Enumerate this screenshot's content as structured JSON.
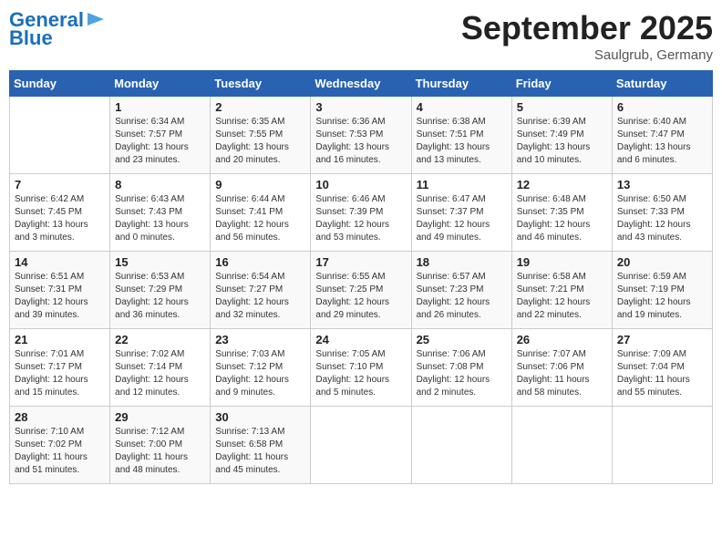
{
  "logo": {
    "line1": "General",
    "line2": "Blue"
  },
  "title": "September 2025",
  "subtitle": "Saulgrub, Germany",
  "headers": [
    "Sunday",
    "Monday",
    "Tuesday",
    "Wednesday",
    "Thursday",
    "Friday",
    "Saturday"
  ],
  "weeks": [
    [
      {
        "day": "",
        "info": ""
      },
      {
        "day": "1",
        "info": "Sunrise: 6:34 AM\nSunset: 7:57 PM\nDaylight: 13 hours\nand 23 minutes."
      },
      {
        "day": "2",
        "info": "Sunrise: 6:35 AM\nSunset: 7:55 PM\nDaylight: 13 hours\nand 20 minutes."
      },
      {
        "day": "3",
        "info": "Sunrise: 6:36 AM\nSunset: 7:53 PM\nDaylight: 13 hours\nand 16 minutes."
      },
      {
        "day": "4",
        "info": "Sunrise: 6:38 AM\nSunset: 7:51 PM\nDaylight: 13 hours\nand 13 minutes."
      },
      {
        "day": "5",
        "info": "Sunrise: 6:39 AM\nSunset: 7:49 PM\nDaylight: 13 hours\nand 10 minutes."
      },
      {
        "day": "6",
        "info": "Sunrise: 6:40 AM\nSunset: 7:47 PM\nDaylight: 13 hours\nand 6 minutes."
      }
    ],
    [
      {
        "day": "7",
        "info": "Sunrise: 6:42 AM\nSunset: 7:45 PM\nDaylight: 13 hours\nand 3 minutes."
      },
      {
        "day": "8",
        "info": "Sunrise: 6:43 AM\nSunset: 7:43 PM\nDaylight: 13 hours\nand 0 minutes."
      },
      {
        "day": "9",
        "info": "Sunrise: 6:44 AM\nSunset: 7:41 PM\nDaylight: 12 hours\nand 56 minutes."
      },
      {
        "day": "10",
        "info": "Sunrise: 6:46 AM\nSunset: 7:39 PM\nDaylight: 12 hours\nand 53 minutes."
      },
      {
        "day": "11",
        "info": "Sunrise: 6:47 AM\nSunset: 7:37 PM\nDaylight: 12 hours\nand 49 minutes."
      },
      {
        "day": "12",
        "info": "Sunrise: 6:48 AM\nSunset: 7:35 PM\nDaylight: 12 hours\nand 46 minutes."
      },
      {
        "day": "13",
        "info": "Sunrise: 6:50 AM\nSunset: 7:33 PM\nDaylight: 12 hours\nand 43 minutes."
      }
    ],
    [
      {
        "day": "14",
        "info": "Sunrise: 6:51 AM\nSunset: 7:31 PM\nDaylight: 12 hours\nand 39 minutes."
      },
      {
        "day": "15",
        "info": "Sunrise: 6:53 AM\nSunset: 7:29 PM\nDaylight: 12 hours\nand 36 minutes."
      },
      {
        "day": "16",
        "info": "Sunrise: 6:54 AM\nSunset: 7:27 PM\nDaylight: 12 hours\nand 32 minutes."
      },
      {
        "day": "17",
        "info": "Sunrise: 6:55 AM\nSunset: 7:25 PM\nDaylight: 12 hours\nand 29 minutes."
      },
      {
        "day": "18",
        "info": "Sunrise: 6:57 AM\nSunset: 7:23 PM\nDaylight: 12 hours\nand 26 minutes."
      },
      {
        "day": "19",
        "info": "Sunrise: 6:58 AM\nSunset: 7:21 PM\nDaylight: 12 hours\nand 22 minutes."
      },
      {
        "day": "20",
        "info": "Sunrise: 6:59 AM\nSunset: 7:19 PM\nDaylight: 12 hours\nand 19 minutes."
      }
    ],
    [
      {
        "day": "21",
        "info": "Sunrise: 7:01 AM\nSunset: 7:17 PM\nDaylight: 12 hours\nand 15 minutes."
      },
      {
        "day": "22",
        "info": "Sunrise: 7:02 AM\nSunset: 7:14 PM\nDaylight: 12 hours\nand 12 minutes."
      },
      {
        "day": "23",
        "info": "Sunrise: 7:03 AM\nSunset: 7:12 PM\nDaylight: 12 hours\nand 9 minutes."
      },
      {
        "day": "24",
        "info": "Sunrise: 7:05 AM\nSunset: 7:10 PM\nDaylight: 12 hours\nand 5 minutes."
      },
      {
        "day": "25",
        "info": "Sunrise: 7:06 AM\nSunset: 7:08 PM\nDaylight: 12 hours\nand 2 minutes."
      },
      {
        "day": "26",
        "info": "Sunrise: 7:07 AM\nSunset: 7:06 PM\nDaylight: 11 hours\nand 58 minutes."
      },
      {
        "day": "27",
        "info": "Sunrise: 7:09 AM\nSunset: 7:04 PM\nDaylight: 11 hours\nand 55 minutes."
      }
    ],
    [
      {
        "day": "28",
        "info": "Sunrise: 7:10 AM\nSunset: 7:02 PM\nDaylight: 11 hours\nand 51 minutes."
      },
      {
        "day": "29",
        "info": "Sunrise: 7:12 AM\nSunset: 7:00 PM\nDaylight: 11 hours\nand 48 minutes."
      },
      {
        "day": "30",
        "info": "Sunrise: 7:13 AM\nSunset: 6:58 PM\nDaylight: 11 hours\nand 45 minutes."
      },
      {
        "day": "",
        "info": ""
      },
      {
        "day": "",
        "info": ""
      },
      {
        "day": "",
        "info": ""
      },
      {
        "day": "",
        "info": ""
      }
    ]
  ]
}
